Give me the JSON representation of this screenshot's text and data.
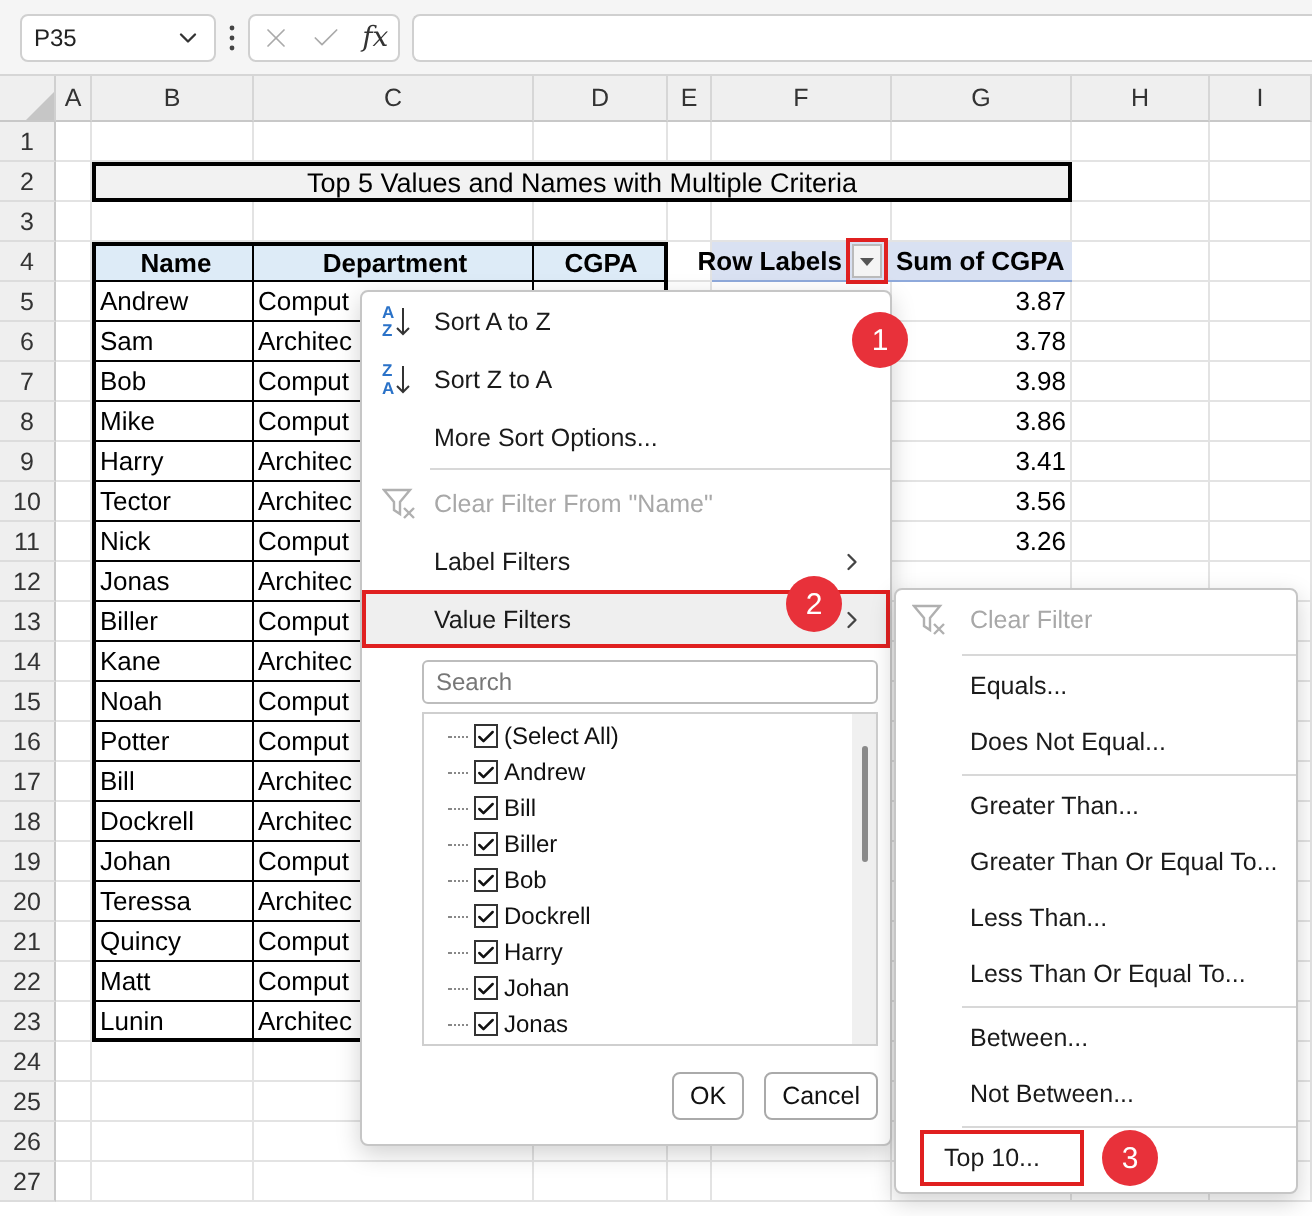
{
  "name_box": "P35",
  "function_label": "fx",
  "column_headers": [
    "A",
    "B",
    "C",
    "D",
    "E",
    "F",
    "G",
    "H",
    "I"
  ],
  "row_headers": [
    "1",
    "2",
    "3",
    "4",
    "5",
    "6",
    "7",
    "8",
    "9",
    "10",
    "11",
    "12",
    "13",
    "14",
    "15",
    "16",
    "17",
    "18",
    "19",
    "20",
    "21",
    "22",
    "23",
    "24",
    "25",
    "26",
    "27"
  ],
  "title": "Top 5 Values and Names with Multiple Criteria",
  "table": {
    "columns": [
      "Name",
      "Department",
      "CGPA"
    ],
    "rows": [
      {
        "name": "Andrew",
        "department": "Comput"
      },
      {
        "name": "Sam",
        "department": "Architec"
      },
      {
        "name": "Bob",
        "department": "Comput"
      },
      {
        "name": "Mike",
        "department": "Comput"
      },
      {
        "name": "Harry",
        "department": "Architec"
      },
      {
        "name": "Tector",
        "department": "Architec"
      },
      {
        "name": "Nick",
        "department": "Comput"
      },
      {
        "name": "Jonas",
        "department": "Architec"
      },
      {
        "name": "Biller",
        "department": "Comput"
      },
      {
        "name": "Kane",
        "department": "Architec"
      },
      {
        "name": "Noah",
        "department": "Comput"
      },
      {
        "name": "Potter",
        "department": "Comput"
      },
      {
        "name": "Bill",
        "department": "Architec"
      },
      {
        "name": "Dockrell",
        "department": "Architec"
      },
      {
        "name": "Johan",
        "department": "Comput"
      },
      {
        "name": "Teressa",
        "department": "Architec"
      },
      {
        "name": "Quincy",
        "department": "Comput"
      },
      {
        "name": "Matt",
        "department": "Comput"
      },
      {
        "name": "Lunin",
        "department": "Architec"
      }
    ]
  },
  "pivot": {
    "columns": [
      "Row Labels",
      "Sum of CGPA"
    ],
    "filter_highlighted": true,
    "values": [
      "3.87",
      "3.78",
      "3.98",
      "3.86",
      "3.41",
      "3.56",
      "3.26"
    ]
  },
  "filter_menu": {
    "items": [
      {
        "kind": "sort",
        "label": "Sort A to Z",
        "glyphs": [
          "A",
          "Z"
        ],
        "disabled": false
      },
      {
        "kind": "sort",
        "label": "Sort Z to A",
        "glyphs": [
          "Z",
          "A"
        ],
        "disabled": false
      },
      {
        "kind": "item",
        "label": "More Sort Options...",
        "disabled": false
      },
      {
        "kind": "separator"
      },
      {
        "kind": "clear",
        "label": "Clear Filter From \"Name\"",
        "disabled": true
      },
      {
        "kind": "submenu",
        "label": "Label Filters",
        "disabled": false,
        "selected": false,
        "highlighted": false
      },
      {
        "kind": "submenu",
        "label": "Value Filters",
        "disabled": false,
        "selected": true,
        "highlighted": true
      }
    ],
    "search": {
      "placeholder": "Search"
    },
    "checklist": [
      {
        "label": "(Select All)",
        "checked": true
      },
      {
        "label": "Andrew",
        "checked": true
      },
      {
        "label": "Bill",
        "checked": true
      },
      {
        "label": "Biller",
        "checked": true
      },
      {
        "label": "Bob",
        "checked": true
      },
      {
        "label": "Dockrell",
        "checked": true
      },
      {
        "label": "Harry",
        "checked": true
      },
      {
        "label": "Johan",
        "checked": true
      },
      {
        "label": "Jonas",
        "checked": true
      }
    ],
    "buttons": [
      "OK",
      "Cancel"
    ]
  },
  "value_filters_menu": {
    "items": [
      {
        "kind": "clear",
        "label": "Clear Filter",
        "disabled": true,
        "highlighted": false
      },
      {
        "kind": "separator"
      },
      {
        "kind": "item",
        "label": "Equals...",
        "disabled": false,
        "highlighted": false
      },
      {
        "kind": "item",
        "label": "Does Not Equal...",
        "disabled": false,
        "highlighted": false
      },
      {
        "kind": "separator"
      },
      {
        "kind": "item",
        "label": "Greater Than...",
        "disabled": false,
        "highlighted": false
      },
      {
        "kind": "item",
        "label": "Greater Than Or Equal To...",
        "disabled": false,
        "highlighted": false
      },
      {
        "kind": "item",
        "label": "Less Than...",
        "disabled": false,
        "highlighted": false
      },
      {
        "kind": "item",
        "label": "Less Than Or Equal To...",
        "disabled": false,
        "highlighted": false
      },
      {
        "kind": "separator"
      },
      {
        "kind": "item",
        "label": "Between...",
        "disabled": false,
        "highlighted": false
      },
      {
        "kind": "item",
        "label": "Not Between...",
        "disabled": false,
        "highlighted": false
      },
      {
        "kind": "separator"
      },
      {
        "kind": "item",
        "label": "Top 10...",
        "disabled": false,
        "highlighted": true
      }
    ]
  },
  "callouts": [
    "1",
    "2",
    "3"
  ]
}
